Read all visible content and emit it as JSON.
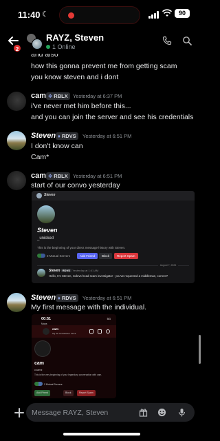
{
  "status_bar": {
    "time": "11:40",
    "battery": "90"
  },
  "header": {
    "unread_badge": "2",
    "title": "RAYZ, Steven",
    "subtitle": "1 Online"
  },
  "messages": [
    {
      "lines": [
        "and also",
        "how this gonna prevent me from getting scam",
        "you know steven and i dont"
      ]
    },
    {
      "author": "cam",
      "tag": "RBLX",
      "timestamp": "Yesterday at 6:37 PM",
      "lines": [
        "i've never met him before this...",
        "and you can join the server and see his credentials"
      ]
    },
    {
      "author": "Steven",
      "tag": "RDVS",
      "timestamp": "Yesterday at 6:51 PM",
      "lines": [
        "I don't know can",
        "Cam*"
      ]
    },
    {
      "author": "cam",
      "tag": "RBLX",
      "timestamp": "Yesterday at 6:51 PM",
      "lines": [
        "start of our convo yesterday"
      ]
    },
    {
      "author": "Steven",
      "tag": "RDVS",
      "timestamp": "Yesterday at 6:51 PM",
      "lines": [
        "My first message with the individual."
      ]
    }
  ],
  "embed1": {
    "top_name": "Steven",
    "display_name": "Steven",
    "username": "_unicked",
    "intro": "This is the beginning of your direct message history with Steven.",
    "mutual": "2 Mutual Servers",
    "buttons": [
      "Add Friend",
      "Block",
      "Report Spam"
    ],
    "date": "August 7, 2026",
    "msg_author": "Steven",
    "msg_tag": "RDVS",
    "msg_time": "Yesterday at 1:41 AM",
    "msg_text": "Hello, I'm Steven, rodevs head scam investigator - you've requested a middleman, correct?"
  },
  "embed2": {
    "time": "00:51",
    "status": "5G",
    "sub": "Maps",
    "bar_name": "cam",
    "bar_sub": "Zig the Grandfather Clock",
    "display_name": "cam",
    "username": "ccamz",
    "intro": "This is the very beginning of your legendary conversation with cam.",
    "mutual": "2 Mutual Servers",
    "buttons": [
      "Add Friend",
      "Block",
      "Report Spam"
    ]
  },
  "composer": {
    "placeholder": "Message RAYZ, Steven"
  },
  "colors": {
    "accent": "#5865f2",
    "online": "#23a55a",
    "badge": "#e02f2f",
    "danger": "#da373c"
  },
  "icons": [
    "back-arrow-icon",
    "call-icon",
    "search-icon",
    "plus-icon",
    "gift-icon",
    "emoji-icon",
    "microphone-icon",
    "moon-icon"
  ]
}
